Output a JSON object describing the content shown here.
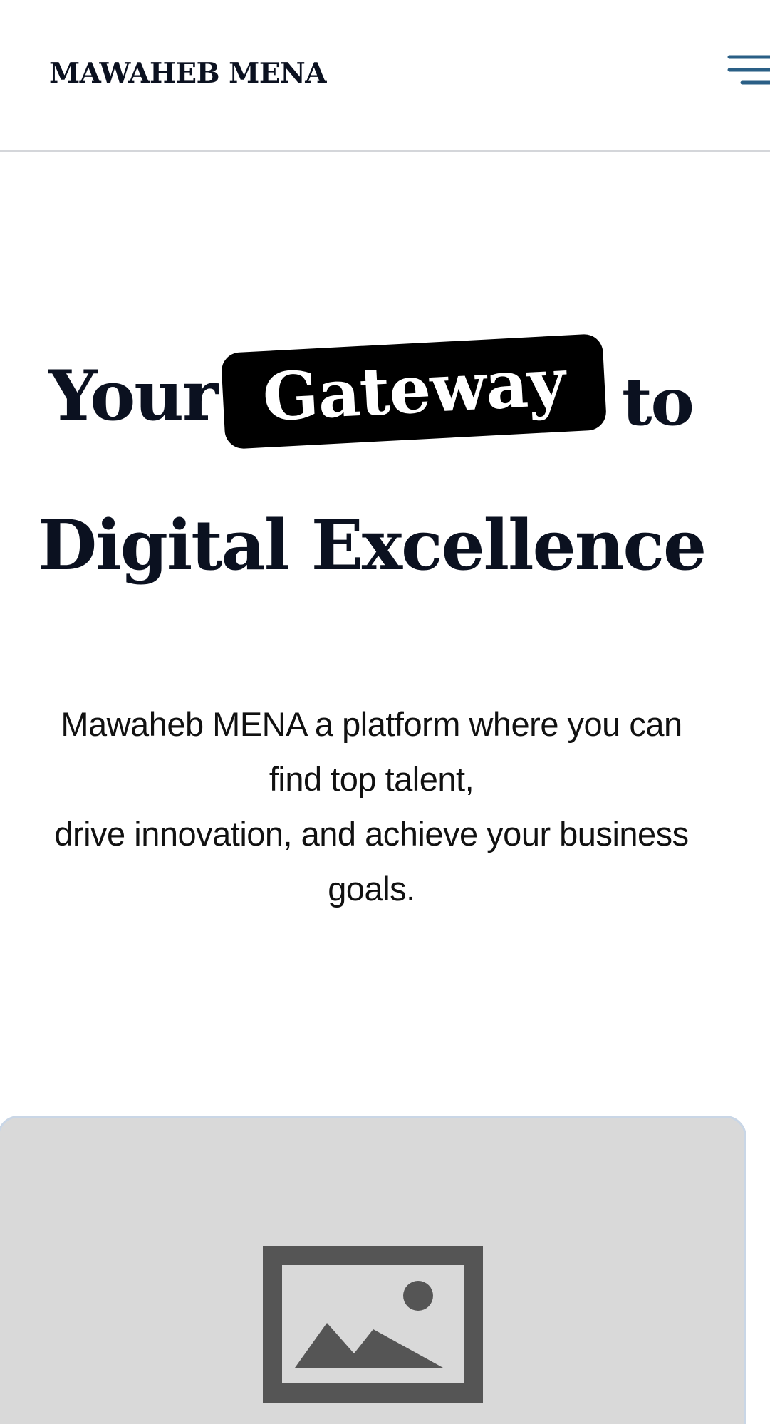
{
  "header": {
    "logo_text": "MAWAHEB MENA",
    "menu_icon": "hamburger-menu-icon"
  },
  "hero": {
    "title_word_1": "Your",
    "title_highlight": "Gateway",
    "title_word_2": "to",
    "title_line_2": "Digital Excellence",
    "description_line_1": "Mawaheb MENA a platform where you can",
    "description_line_2": "find top talent,",
    "description_line_3": "drive innovation, and achieve your business",
    "description_line_4": "goals."
  },
  "media": {
    "icon": "image-placeholder-icon"
  },
  "colors": {
    "text_dark": "#0b1120",
    "highlight_bg": "#000000",
    "highlight_text": "#ffffff",
    "menu_icon": "#2a5f86",
    "card_bg": "#d9d9d9",
    "card_border": "#c9d6e6",
    "placeholder_icon": "#555555",
    "header_border": "#d4d6da"
  }
}
